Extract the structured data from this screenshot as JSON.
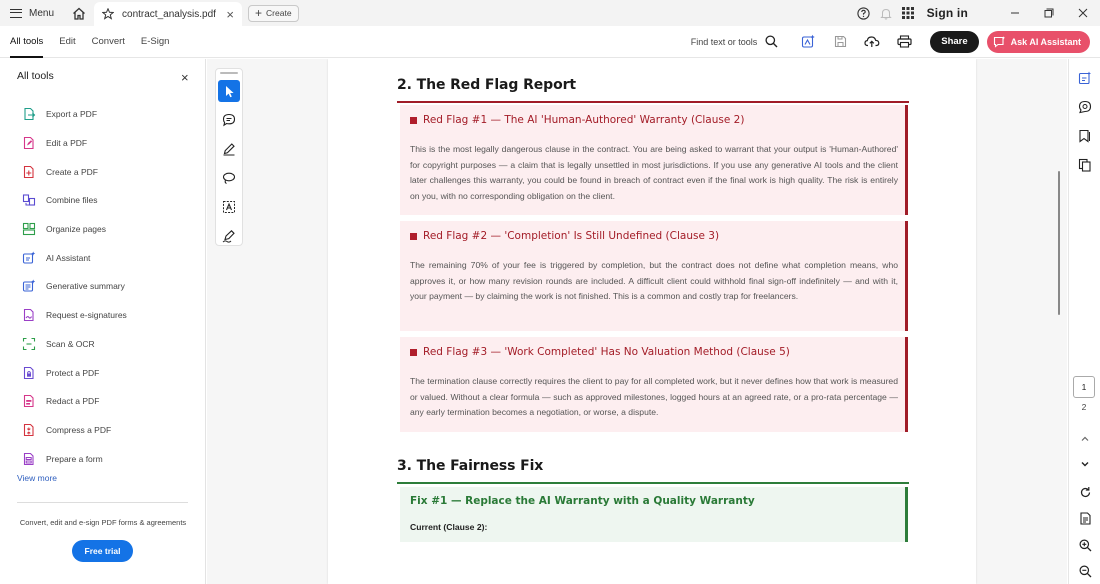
{
  "titlebar": {
    "menu_label": "Menu",
    "tab_title": "contract_analysis.pdf",
    "create_label": "Create",
    "sign_in": "Sign in"
  },
  "toolbar": {
    "tabs": [
      {
        "label": "All tools",
        "active": true
      },
      {
        "label": "Edit",
        "active": false
      },
      {
        "label": "Convert",
        "active": false
      },
      {
        "label": "E-Sign",
        "active": false
      }
    ],
    "find_text": "Find text or tools",
    "share_label": "Share",
    "ai_label": "Ask AI Assistant"
  },
  "left_panel": {
    "title": "All tools",
    "tools": [
      {
        "label": "Export a PDF",
        "icon": "export-pdf-icon",
        "color": "#1f9e8a"
      },
      {
        "label": "Edit a PDF",
        "icon": "edit-pdf-icon",
        "color": "#d6368a"
      },
      {
        "label": "Create a PDF",
        "icon": "create-pdf-icon",
        "color": "#d4343f"
      },
      {
        "label": "Combine files",
        "icon": "combine-files-icon",
        "color": "#5a4bd1"
      },
      {
        "label": "Organize pages",
        "icon": "organize-pages-icon",
        "color": "#2e9e4a"
      },
      {
        "label": "AI Assistant",
        "icon": "ai-assistant-icon",
        "color": "#3a63d6"
      },
      {
        "label": "Generative summary",
        "icon": "generative-summary-icon",
        "color": "#3a63d6"
      },
      {
        "label": "Request e-signatures",
        "icon": "request-esignatures-icon",
        "color": "#9a3fc6"
      },
      {
        "label": "Scan & OCR",
        "icon": "scan-ocr-icon",
        "color": "#2e9e4a"
      },
      {
        "label": "Protect a PDF",
        "icon": "protect-pdf-icon",
        "color": "#6a4bd1"
      },
      {
        "label": "Redact a PDF",
        "icon": "redact-pdf-icon",
        "color": "#d6368a"
      },
      {
        "label": "Compress a PDF",
        "icon": "compress-pdf-icon",
        "color": "#d4343f"
      },
      {
        "label": "Prepare a form",
        "icon": "prepare-form-icon",
        "color": "#9a3fc6"
      }
    ],
    "view_more": "View more",
    "promo": "Convert, edit and e-sign PDF forms & agreements",
    "free_trial": "Free trial"
  },
  "document": {
    "section2_heading": "2. The Red Flag Report",
    "flags": [
      {
        "title": "Red Flag #1 — The AI 'Human-Authored' Warranty (Clause 2)",
        "body": "This is the most legally dangerous clause in the contract. You are being asked to warrant that your output is 'Human-Authored' for copyright purposes — a claim that is legally unsettled in most jurisdictions. If you use any generative AI tools and the client later challenges this warranty, you could be found in breach of contract even if the final work is high quality. The risk is entirely on you, with no corresponding obligation on the client."
      },
      {
        "title": "Red Flag #2 — 'Completion' Is Still Undefined (Clause 3)",
        "body": "The remaining 70% of your fee is triggered by completion, but the contract does not define what completion means, who approves it, or how many revision rounds are included. A difficult client could withhold final sign-off indefinitely — and with it, your payment — by claiming the work is not finished. This is a common and costly trap for freelancers."
      },
      {
        "title": "Red Flag #3 — 'Work Completed' Has No Valuation Method (Clause 5)",
        "body": "The termination clause correctly requires the client to pay for all completed work, but it never defines how that work is measured or valued. Without a clear formula — such as approved milestones, logged hours at an agreed rate, or a pro-rata percentage — any early termination becomes a negotiation, or worse, a dispute."
      }
    ],
    "section3_heading": "3. The Fairness Fix",
    "fix_title": "Fix #1 — Replace the AI Warranty with a Quality Warranty",
    "fix_current": "Current (Clause 2):"
  },
  "page_nav": {
    "current": "1",
    "next": "2"
  },
  "colors": {
    "accent_blue": "#1473e6",
    "ai_pink": "#e8506a",
    "flag_red": "#a31c27",
    "flag_bg": "#fdeef0",
    "fix_green": "#2a7a37",
    "fix_bg": "#eef6f0"
  }
}
